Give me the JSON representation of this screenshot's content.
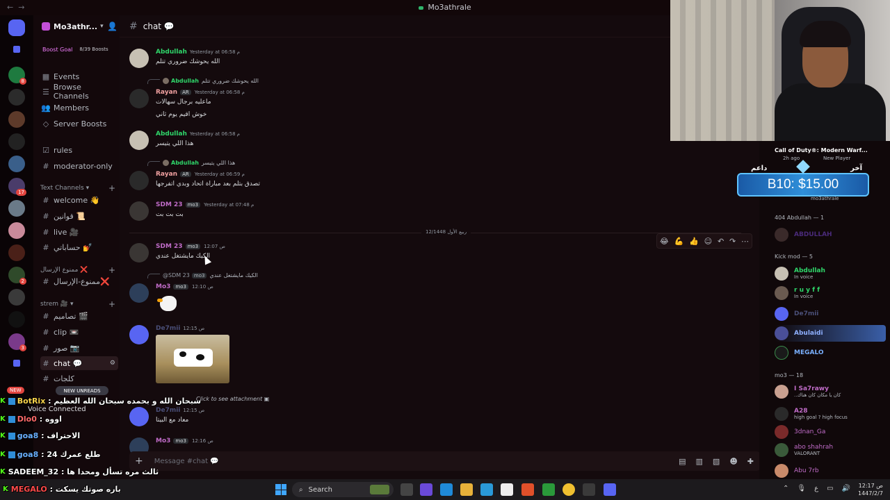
{
  "window": {
    "title": "Mo3athrale",
    "nav_back": "←",
    "nav_fwd": "→"
  },
  "server": {
    "name": "Mo3athr...",
    "boost_goal": "Boost Goal",
    "boosts": "8/39 Boosts"
  },
  "nav": {
    "events": "Events",
    "browse_channels": "Browse Channels",
    "members": "Members",
    "server_boosts": "Server Boosts"
  },
  "channels": {
    "rules": "rules",
    "moderator_only": "moderator-only",
    "text_category": "Text Channels",
    "welcome": "welcome 👋",
    "qawanin": "قوانين 📜",
    "live": "live 🎥",
    "hasabati": "حساباتي 💅",
    "forbidden_category": "ممنوع الإرسال ❌",
    "forbidden": "ممنوع-الإرسال❌",
    "strem_category": "strem 🎥",
    "tasamim": "تصاميم 🎬",
    "clip": "clip 📼",
    "suwar": "صور 📷",
    "chat": "chat 💬",
    "kalijat": "كلجات",
    "new_unreads": "NEW UNREADS",
    "new": "NEW",
    "voice_connected": "Voice Connected"
  },
  "header": {
    "channel": "chat 💬"
  },
  "messages": [
    {
      "name": "Abdullah",
      "time": "Yesterday at 06:58 م",
      "text": "الله يحوشك ضروري تتلم"
    },
    {
      "reply_name": "Abdullah",
      "reply_text": "الله يحوشك ضروري تتلم",
      "name": "Rayan",
      "tag": "AR",
      "time": "Yesterday at 06:58 م",
      "text": "ماعليه برجال سهالات",
      "text2": "خوش اقيم يوم ثاني"
    },
    {
      "name": "Abdullah",
      "time": "Yesterday at 06:58 م",
      "text": "هذا اللي يتيسر"
    },
    {
      "reply_name": "Abdullah",
      "reply_text": "هذا اللي يتيسر",
      "name": "Rayan",
      "tag": "AR",
      "time": "Yesterday at 06:59 م",
      "text": "تصدق بتلم بعد مباراة اتحاد وبدي اتفرجها"
    },
    {
      "name": "SDM 23",
      "tag": "mo3",
      "time": "Yesterday at 07:48 م",
      "text": "بت بت بت"
    },
    {
      "name": "SDM 23",
      "tag": "mo3",
      "time": "12:07 ص",
      "text": "الكيك مايشتغل عندي"
    },
    {
      "reply_name": "@SDM 23",
      "reply_tag": "mo3",
      "reply_text": "الكيك مايشتغل عندي",
      "name": "Mo3",
      "tag": "mo3",
      "time": "12:10 ص"
    },
    {
      "name": "De7mii",
      "time": "12:15 ص"
    },
    {
      "reply_text": "Click to see attachment",
      "name": "De7mii",
      "time": "12:15 ص",
      "text": "معاد مع البيتا"
    },
    {
      "name": "Mo3",
      "tag": "mo3",
      "time": "12:16 ص"
    }
  ],
  "date_divider": "ربيع الأول 12/1448",
  "composer": {
    "placeholder": "Message #chat 💬"
  },
  "members": {
    "activity_title": "Call of Duty®: Modern Warf...",
    "activity_sub": "2h ago",
    "activity_badge": "New Player",
    "activity_user": "mo3athrale",
    "group1": "404 Abdullah — 1",
    "g1_m1": "ABDULLAH",
    "group2": "Kick mod — 5",
    "g2": [
      {
        "name": "Abdullah",
        "sub": "In voice"
      },
      {
        "name": "r u y f f",
        "sub": "In voice"
      },
      {
        "name": "De7mii",
        "sub": ""
      },
      {
        "name": "Abulaidi",
        "sub": ""
      },
      {
        "name": "MEGALO",
        "sub": ""
      }
    ],
    "group3": "mo3 — 18",
    "g3": [
      {
        "name": "I Sa7rawy",
        "sub": "..كان يا مكان كان هناك"
      },
      {
        "name": "A28",
        "sub": "high goal ? high focus"
      },
      {
        "name": "3dnan_Ga",
        "sub": ""
      },
      {
        "name": "abo shahrah",
        "sub": "VALORANT"
      },
      {
        "name": "Abu 7rb",
        "sub": ""
      }
    ]
  },
  "alert": {
    "left": "داعم",
    "right": "آخر",
    "text": "B10: $15.00"
  },
  "overlay_chat": [
    {
      "user": "BotRix",
      "text": "سبحان الله و بحمده سبحان الله العظيم"
    },
    {
      "user": "Dlo0",
      "text": "اووه"
    },
    {
      "user": "goa8",
      "text": "الاحتراف"
    },
    {
      "user": "goa8",
      "text": "طلع عمرك 24"
    },
    {
      "user": "SADEEM_32",
      "text": "ثالث مره تسأل ومحدا ها"
    },
    {
      "user": "MEGALO",
      "text": "باره صوتك يسكت"
    }
  ],
  "taskbar": {
    "search": "Search",
    "time": "12:17 ص",
    "date": "1447/2/7"
  }
}
